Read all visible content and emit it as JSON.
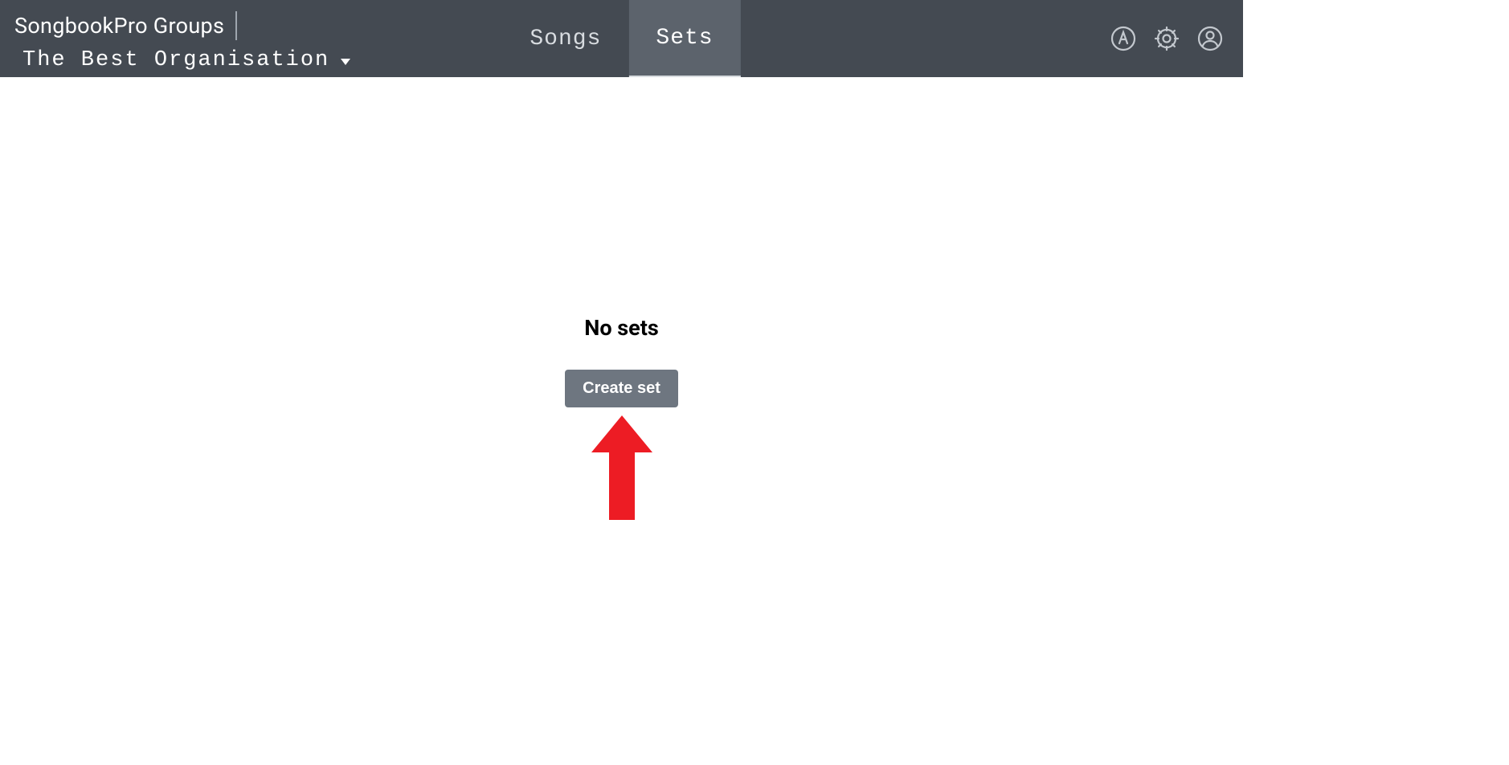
{
  "header": {
    "app_title": "SongbookPro Groups",
    "organisation_name": "The Best Organisation"
  },
  "tabs": {
    "songs": {
      "label": "Songs",
      "active": false
    },
    "sets": {
      "label": "Sets",
      "active": true
    }
  },
  "main": {
    "empty_heading": "No sets",
    "create_button_label": "Create set"
  },
  "icons": {
    "admin": "admin-a-icon",
    "settings": "gear-icon",
    "profile": "person-circle-icon"
  },
  "annotation": {
    "arrow_color": "#ed1c24"
  }
}
